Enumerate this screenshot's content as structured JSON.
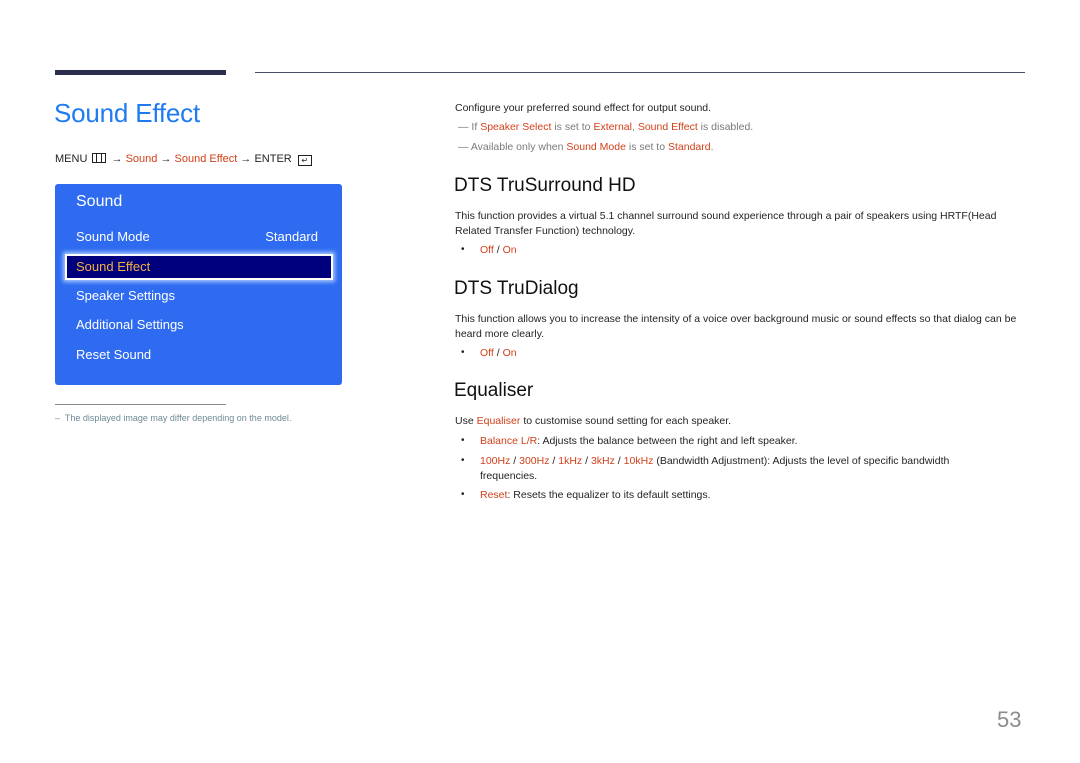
{
  "header": {
    "title": "Sound Effect"
  },
  "breadcrumb": {
    "menu": "MENU",
    "menu_icon": "menu-grid-icon",
    "arrow": "→",
    "sound": "Sound",
    "sound_effect": "Sound Effect",
    "enter": "ENTER",
    "enter_icon": "enter-icon",
    "enter_glyph": "↵"
  },
  "panel": {
    "title": "Sound",
    "items": [
      {
        "label": "Sound Mode",
        "value": "Standard"
      },
      {
        "label": "Sound Effect",
        "selected": true
      },
      {
        "label": "Speaker Settings"
      },
      {
        "label": "Additional Settings"
      },
      {
        "label": "Reset Sound"
      }
    ]
  },
  "footnote": {
    "dash": "–",
    "text": "The displayed image may differ depending on the model."
  },
  "intro": {
    "text": "Configure your preferred sound effect for output sound.",
    "note1": {
      "dash": "―",
      "pre": "If",
      "speaker_select": "Speaker Select",
      "mid": "is set to",
      "external": "External",
      "comma": ",",
      "sound_effect": "Sound Effect",
      "post": "is disabled."
    },
    "note2": {
      "dash": "―",
      "pre": "Available only when",
      "sound_mode": "Sound Mode",
      "mid": "is set to",
      "standard": "Standard",
      "post": "."
    }
  },
  "sections": {
    "trusurround": {
      "heading": "DTS TruSurround HD",
      "body": "This function provides a virtual 5.1 channel surround sound experience through a pair of speakers using HRTF(Head Related Transfer Function) technology.",
      "opt_off": "Off",
      "sep": " / ",
      "opt_on": "On"
    },
    "trudialog": {
      "heading": "DTS TruDialog",
      "body": "This function allows you to increase the intensity of a voice over background music or sound effects so that dialog can be heard more clearly.",
      "opt_off": "Off",
      "sep": " / ",
      "opt_on": "On"
    },
    "equaliser": {
      "heading": "Equaliser",
      "intro_pre": "Use",
      "intro_link": "Equaliser",
      "intro_post": "to customise sound setting for each speaker.",
      "balance_label": "Balance L/R",
      "balance_text": ": Adjusts the balance between the right and left speaker.",
      "bands": [
        "100Hz",
        "300Hz",
        "1kHz",
        "3kHz",
        "10kHz"
      ],
      "band_sep": " / ",
      "bands_text": " (Bandwidth Adjustment): Adjusts the level of specific bandwidth frequencies.",
      "reset_label": "Reset",
      "reset_text": ": Resets the equalizer to its default settings."
    }
  },
  "bullet_glyph": "•",
  "page_number": "53",
  "colors": {
    "title_blue": "#1f7bf2",
    "highlight_red": "#d2401a",
    "panel_blue": "#2f6bf0",
    "selected_bg": "#00007d",
    "selected_text": "#f6b13c"
  }
}
